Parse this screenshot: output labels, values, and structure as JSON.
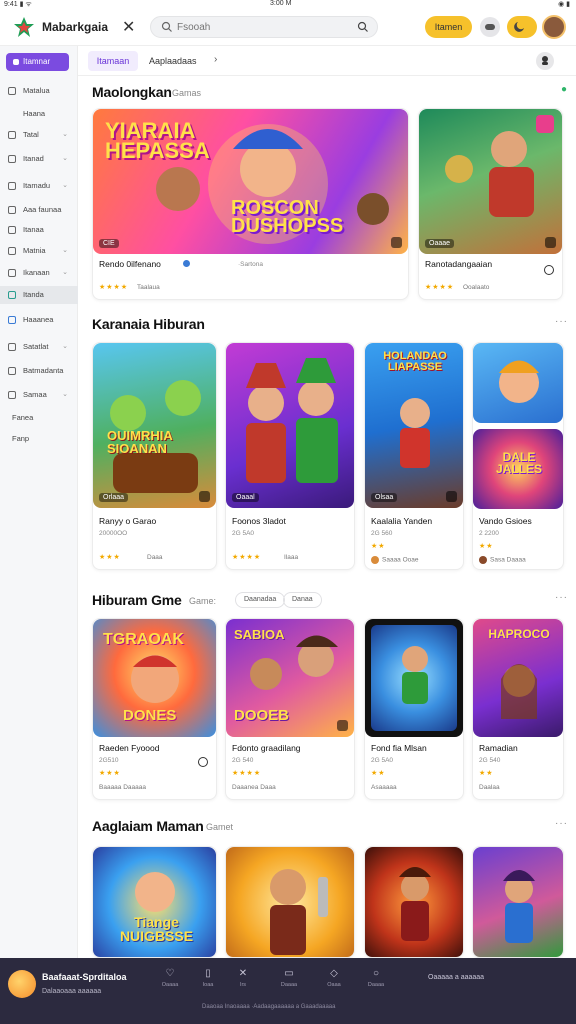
{
  "status": {
    "left": "9:41 ▮ ᯤ",
    "time": "3:00 M",
    "right": "◉ ▮"
  },
  "header": {
    "title": "Mabarkgaia",
    "close": "✕",
    "search_placeholder": "Fsooah",
    "btn_primary": "Itamen"
  },
  "sidebar": {
    "top": "Itamnar",
    "items": [
      {
        "label": "Matalua",
        "chevron": ""
      },
      {
        "label": "Haana",
        "chevron": ""
      },
      {
        "label": "Tatal",
        "chevron": "⌄"
      },
      {
        "label": "Itanad",
        "chevron": "⌄"
      },
      {
        "label": "Itamadu",
        "chevron": "⌄"
      },
      {
        "label": "Aaa faunaa",
        "chevron": ""
      },
      {
        "label": "Itanaa",
        "chevron": ""
      },
      {
        "label": "Matnia",
        "chevron": "⌄"
      },
      {
        "label": "Ikanaan",
        "chevron": "⌄"
      },
      {
        "label": "Itanda",
        "chevron": ""
      },
      {
        "label": "Haaanea",
        "chevron": ""
      },
      {
        "label": "Satatlat",
        "chevron": "⌄"
      },
      {
        "label": "Batmadanta",
        "chevron": ""
      },
      {
        "label": "Samaa",
        "chevron": "⌄"
      },
      {
        "label": "Fanea",
        "chevron": ""
      },
      {
        "label": "Fanp",
        "chevron": ""
      }
    ]
  },
  "subnav": {
    "tab_active": "Itamaan",
    "tab_other": "Aaplaadaas",
    "chevron": "›"
  },
  "sections": [
    {
      "title": "Maolongkan",
      "subtitle": "Gamas",
      "more": "●"
    },
    {
      "title": "Karanaia Hiburan",
      "subtitle": "",
      "more": "···"
    },
    {
      "title": "Hiburam Gme",
      "subtitle": "Game:",
      "chips": [
        "Daanadaa",
        "Danaa"
      ],
      "more": "···"
    },
    {
      "title": "Aaglaiam Maman",
      "subtitle": "Gamet",
      "more": "···"
    }
  ],
  "row1": [
    {
      "title": "Rendo 0ilfenano",
      "meta": "·Sartona",
      "badge": "CIE",
      "art": "YIARAIA HEPASSA",
      "art2": "ROSCON DUSHOPSS",
      "stars": "★★★★",
      "foot": "Taalaua"
    },
    {
      "title": "Ranotadangaaian",
      "meta": "",
      "badge": "Oaaae",
      "stars": "★★★★",
      "foot": "Ooalaato"
    }
  ],
  "row2": [
    {
      "title": "Ranyy o Garao",
      "meta": "20000OO",
      "badge": "Orlaaa",
      "art": "OUIMRHIA SIOANAN",
      "stars": "★★★",
      "foot": "Daaa"
    },
    {
      "title": "Foonos 3ladot",
      "meta": "2G 5A0",
      "badge": "Oaaal",
      "stars": "★★★★",
      "foot": "Ilaaa"
    },
    {
      "title": "Kaalalia Yanden",
      "meta": "2G 560",
      "badge": "Olsaa",
      "art": "HOLANDAO LIAPASSE",
      "stars": "★★",
      "foot": "Saaaa Ooae"
    },
    {
      "title": "Vando Gsioes",
      "meta": "2 2200",
      "art": "DALE JALLES",
      "stars": "★★",
      "foot": "Sasa Daaaa"
    }
  ],
  "row3": [
    {
      "title": "Raeden Fyoood",
      "meta": "2G510",
      "art": "TGRAOAK",
      "art2": "DONES",
      "stars": "★★★",
      "foot": "Baaaaa Daaaaa"
    },
    {
      "title": "Fdonto graadilang",
      "meta": "2G 540",
      "art": "SABIOA",
      "art2": "DOOEB",
      "stars": "★★★★",
      "foot": "Daaanea   Daaa"
    },
    {
      "title": "Fond fia Mlsan",
      "meta": "2G 5A0",
      "stars": "★★",
      "foot": "Asaaaaa"
    },
    {
      "title": "Ramadian",
      "meta": "2G 540",
      "art": "HAPROCO",
      "stars": "★★",
      "foot": "Daalaa"
    }
  ],
  "row4": [
    {
      "art": "Tiange NUIGBSSE"
    },
    {},
    {},
    {}
  ],
  "bottom": {
    "title": "Baafaaat-Sprditaloa",
    "sub": "Dalaaoaaa aaaaaa",
    "icons": [
      "Oaaaa",
      "Ioaa",
      "Irs",
      "Daaaa",
      "Oaaa",
      "Daaaa"
    ],
    "right": "Oaaaaa a aaaaaa",
    "footer": "Daaoaa Inaoaaaa ·Aadaagaaaaaa a Gaaadaaaaa"
  }
}
